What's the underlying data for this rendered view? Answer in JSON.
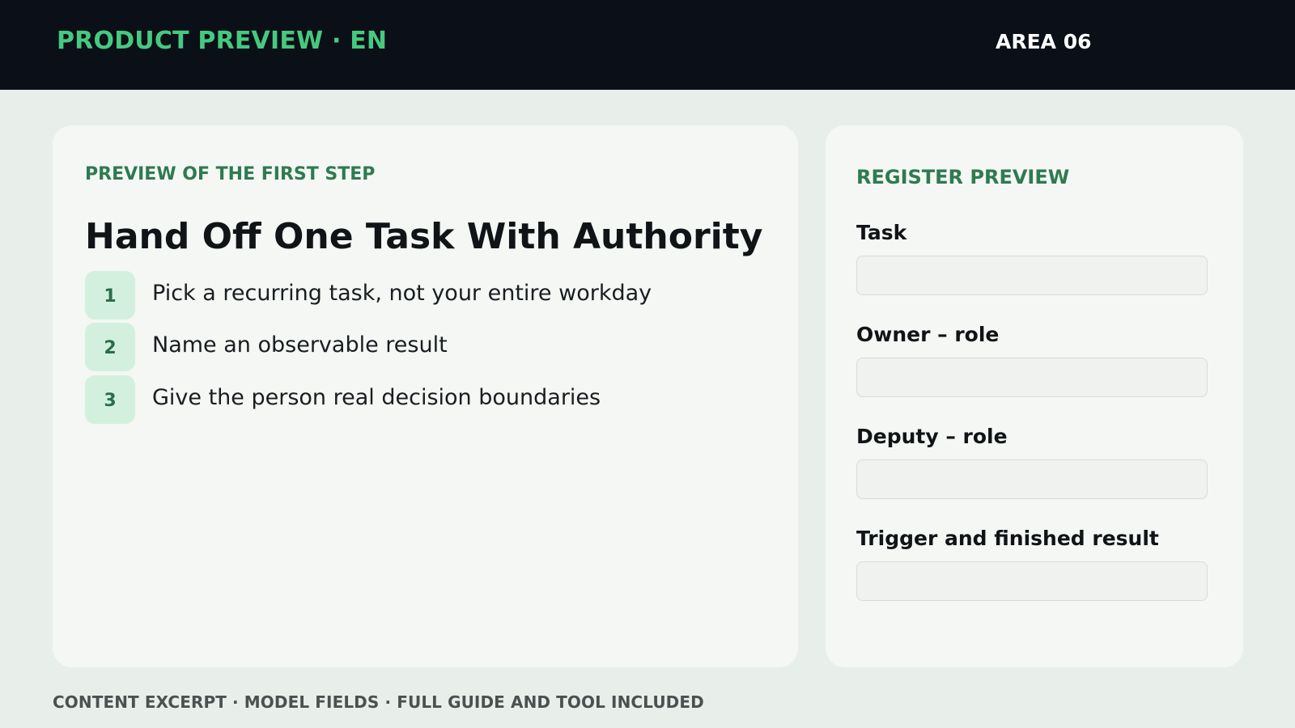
{
  "header": {
    "title": "PRODUCT PREVIEW · EN",
    "area": "AREA 06"
  },
  "main": {
    "eyebrow": "PREVIEW OF THE FIRST STEP",
    "title": "Hand Off One Task With Authority",
    "steps": [
      {
        "number": "1",
        "text": "Pick a recurring task, not your entire workday"
      },
      {
        "number": "2",
        "text": "Name an observable result"
      },
      {
        "number": "3",
        "text": "Give the person real decision boundaries"
      }
    ]
  },
  "register": {
    "eyebrow": "REGISTER PREVIEW",
    "fields": [
      {
        "label": "Task",
        "value": "",
        "placeholder": ""
      },
      {
        "label": "Owner – role",
        "value": "",
        "placeholder": ""
      },
      {
        "label": "Deputy – role",
        "value": "",
        "placeholder": ""
      },
      {
        "label": "Trigger and finished result",
        "value": "",
        "placeholder": ""
      }
    ]
  },
  "footer": {
    "text": "CONTENT EXCERPT · MODEL FIELDS · FULL GUIDE AND TOOL INCLUDED"
  },
  "colors": {
    "topbar": "#0b0f17",
    "accent": "#46c97f",
    "eyebrow": "#2f7a51",
    "badge": "#d3f0df",
    "background": "#e8efeb",
    "card": "#f4f7f4"
  }
}
